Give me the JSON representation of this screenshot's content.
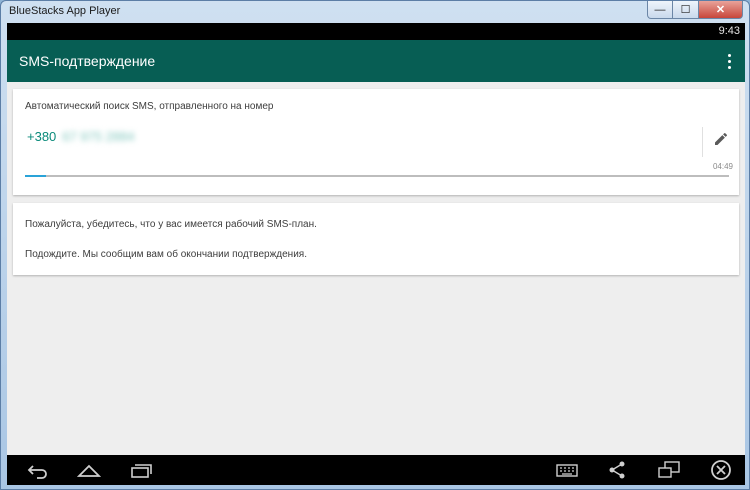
{
  "window": {
    "title": "BlueStacks App Player",
    "min_glyph": "—",
    "max_glyph": "☐",
    "close_glyph": "✕"
  },
  "status_bar": {
    "time": "9:43"
  },
  "app_bar": {
    "title": "SMS-подтверждение",
    "menu_icon": "overflow-menu-icon"
  },
  "verify_card": {
    "auto_search_text": "Автоматический поиск SMS, отправленного на номер",
    "phone_code": "+380",
    "phone_number_hidden": "67 975 2884",
    "edit_icon": "pencil-icon",
    "timer": "04:49",
    "progress": 0.03,
    "accent_color": "#2aa3d8"
  },
  "info_card": {
    "line1": "Пожалуйста, убедитесь, что у вас имеется рабочий SMS-план.",
    "line2": "Подождите. Мы сообщим вам об окончании подтверждения."
  },
  "nav_bar": {
    "icons": [
      "back-icon",
      "home-icon",
      "recent-apps-icon",
      "keyboard-icon",
      "share-icon",
      "screen-rotate-icon",
      "close-circle-icon"
    ]
  },
  "colors": {
    "app_bar": "#075e54",
    "phone_text": "#0a8a7a",
    "background": "#eeeeee"
  }
}
